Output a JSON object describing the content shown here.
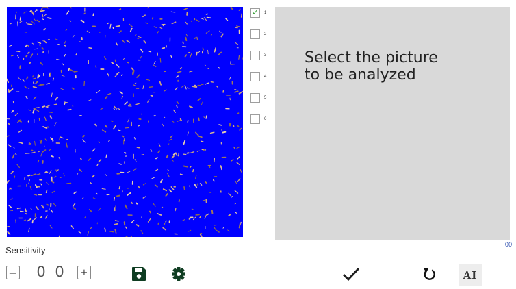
{
  "pictures": [
    {
      "label": "1",
      "checked": true
    },
    {
      "label": "2",
      "checked": false
    },
    {
      "label": "3",
      "checked": false
    },
    {
      "label": "4",
      "checked": false
    },
    {
      "label": "5",
      "checked": false
    },
    {
      "label": "6",
      "checked": false
    }
  ],
  "message": "Select the picture\nto be analyzed",
  "counter": "00",
  "sensitivity": {
    "label": "Sensitivity",
    "minus": "−",
    "plus": "+",
    "digits": [
      "0",
      "0"
    ]
  },
  "toolbar": {
    "ai_label": "AI",
    "icons": [
      "save-icon",
      "gear-icon",
      "checkmark-icon",
      "reset-icon"
    ]
  },
  "colors": {
    "canvas_background": "#0000ff",
    "message_panel": "#d9d9d9",
    "icon_dark_green": "#0f3d22",
    "checkbox_check": "#3aa13a",
    "counter_text": "#1a3fa8"
  }
}
